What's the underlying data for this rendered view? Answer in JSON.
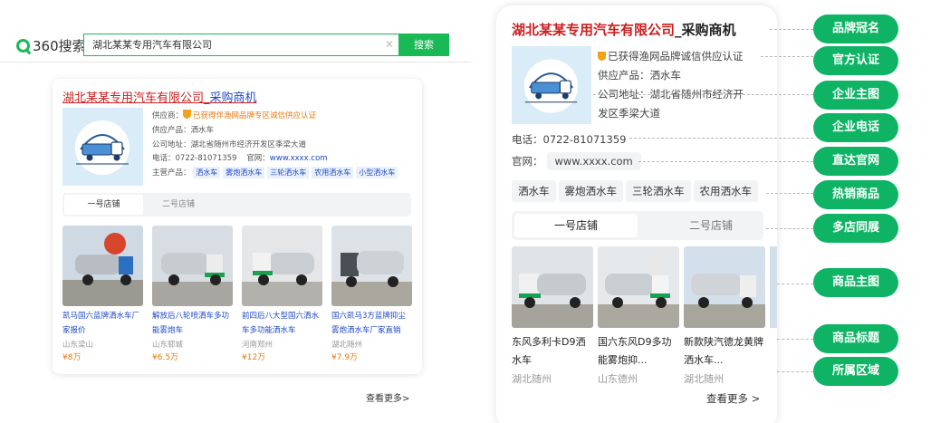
{
  "search": {
    "logo_text": "360搜索",
    "query": "湖北某某专用汽车有限公司",
    "button_label": "搜索"
  },
  "result": {
    "title_main": "湖北某某专用汽车有限公司",
    "title_suffix": "_采购商机",
    "supplier_label": "供应商：",
    "cert_text": "已获得伴渔网品牌专区诚信供应认证",
    "supply_text": "供应产品：洒水车",
    "address_text": "公司地址：湖北省随州市经济开发区季梁大道",
    "phone_text": "电话：0722-81071359",
    "website_label": "官网：",
    "website_url": "www.xxxx.com",
    "main_products_label": "主营产品：",
    "main_tags": [
      "洒水车",
      "雾炮洒水车",
      "三轮洒水车",
      "农用洒水车",
      "小型洒水车"
    ],
    "tabs": [
      "一号店铺",
      "二号店铺"
    ],
    "products": [
      {
        "title": "凯马国六蓝牌洒水车厂家报价",
        "location": "山东梁山",
        "price": "¥8万"
      },
      {
        "title": "解放后八轮喷洒车多功能雾炮车",
        "location": "山东郓城",
        "price": "¥6.5万"
      },
      {
        "title": "前四后八大型国六洒水车多功能洒水车",
        "location": "河南郑州",
        "price": "¥12万"
      },
      {
        "title": "国六凯马3方蓝牌抑尘雾炮洒水车厂家直销",
        "location": "湖北随州",
        "price": "¥7.9万"
      }
    ],
    "more_label": "查看更多>"
  },
  "mobile": {
    "title_main": "湖北某某专用汽车有限公司",
    "title_suffix": "_采购商机",
    "cert_text": "已获得渔网品牌诚信供应认证",
    "supply_text": "供应产品：洒水车",
    "address_line1": "公司地址：湖北省随州市经济开",
    "address_line2": "发区季梁大道",
    "phone_text": "电话：0722-81071359",
    "website_label": "官网：",
    "website_url": "www.xxxx.com",
    "tags": [
      "洒水车",
      "雾炮洒水车",
      "三轮洒水车",
      "农用洒水车"
    ],
    "tabs": [
      "一号店铺",
      "二号店铺"
    ],
    "products": [
      {
        "title": "东风多利卡D9洒水车",
        "location": "湖北随州"
      },
      {
        "title": "国六东风D9多功能雾炮抑...",
        "location": "山东德州"
      },
      {
        "title": "新款陕汽德龙黄牌洒水车...",
        "location": "湖北随州"
      }
    ],
    "more_label": "查看更多"
  },
  "callouts": [
    "品牌冠名",
    "官方认证",
    "企业主图",
    "企业电话",
    "直达官网",
    "热销商品",
    "多店同展",
    "商品主图",
    "商品标题",
    "所属区域"
  ],
  "colors": {
    "brand_green": "#19b955",
    "callout_green": "#0eb464",
    "title_red": "#cc1f1f",
    "link_blue": "#1f4ac8",
    "price_orange": "#e8790f"
  }
}
